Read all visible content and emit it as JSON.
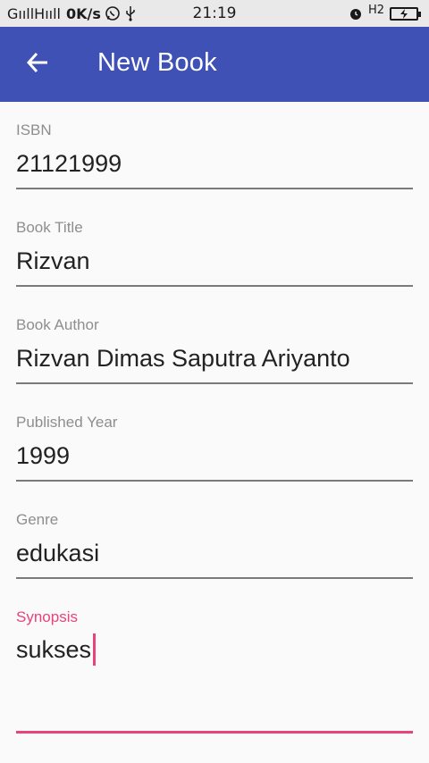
{
  "statusbar": {
    "carrier": "GııllHııll",
    "speed": "0K/s",
    "time": "21:19",
    "h2": "H2",
    "icons": [
      "whatsapp-icon",
      "usb-icon",
      "alarm-icon",
      "battery-charging-icon"
    ]
  },
  "appbar": {
    "title": "New Book",
    "back_icon": "arrow-left-icon",
    "color": "#3f51b5"
  },
  "form": {
    "isbn": {
      "label": "ISBN",
      "value": "21121999"
    },
    "title": {
      "label": "Book Title",
      "value": "Rizvan"
    },
    "author": {
      "label": "Book Author",
      "value": "Rizvan Dimas Saputra Ariyanto"
    },
    "year": {
      "label": "Published Year",
      "value": "1999"
    },
    "genre": {
      "label": "Genre",
      "value": "edukasi"
    },
    "synopsis": {
      "label": "Synopsis",
      "value": "sukses"
    }
  },
  "colors": {
    "accent": "#e8437a",
    "primary": "#3f51b5",
    "label": "#8e8e8e",
    "text": "#222222"
  }
}
